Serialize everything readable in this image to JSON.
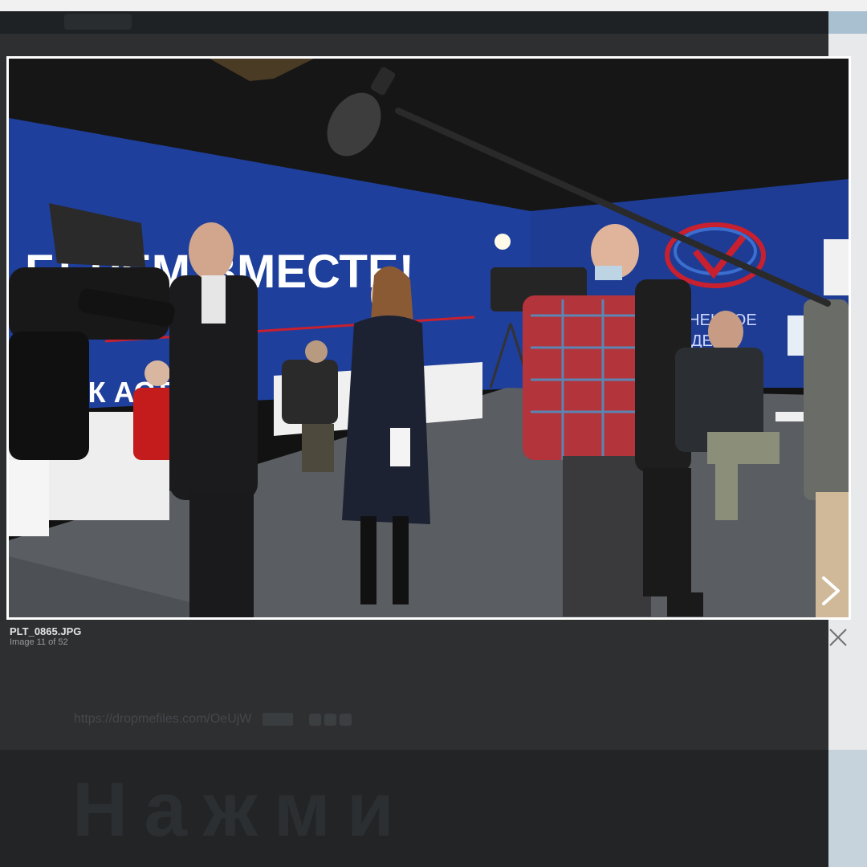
{
  "page": {
    "header_pill": "",
    "share_url": "https://dropmefiles.com/OeUjW",
    "copy_label": "",
    "blurred_heading": "Нажми"
  },
  "lightbox": {
    "filename": "PLT_0865.JPG",
    "counter": "Image 11 of 52",
    "next_icon": "chevron-right-icon",
    "close_icon": "close-icon"
  },
  "photo": {
    "banner_text": "БЕРЕМ ВМЕСТЕ!",
    "banner_text_lower": "ОВСК  АСТИ",
    "logo_text_1": "ЦЕНЕННОЕ",
    "logo_text_2": "ДЕНИ"
  },
  "colors": {
    "overlay": "#2e2f31",
    "banner_blue": "#1f3f9c",
    "accent_red": "#c8202e"
  }
}
